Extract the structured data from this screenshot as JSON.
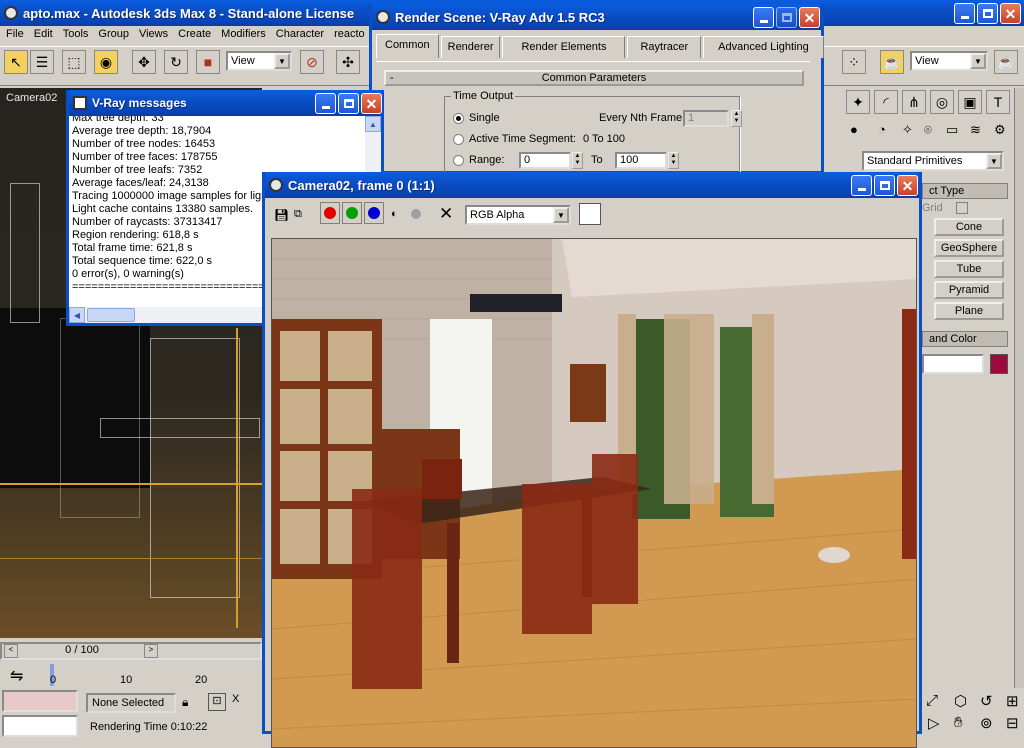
{
  "main_window": {
    "title": "apto.max - Autodesk 3ds Max 8   - Stand-alone License"
  },
  "menu": [
    "File",
    "Edit",
    "Tools",
    "Group",
    "Views",
    "Create",
    "Modifiers",
    "Character",
    "reacto"
  ],
  "toolbar": {
    "ref_coord": "View",
    "ref_coord_right": "View"
  },
  "viewport": {
    "label": "Camera02"
  },
  "vray_messages": {
    "title": "V-Ray messages",
    "lines": [
      "Max tree depth: 33",
      "Average tree depth: 18,7904",
      "Number of tree nodes: 16453",
      "Number of tree faces: 178755",
      "Number of tree leafs: 7352",
      "Average faces/leaf: 24,3138",
      "Tracing 1000000 image samples for ligh",
      "Light cache contains 13380 samples.",
      "Number of raycasts: 37313417",
      "Region rendering: 618,8 s",
      "Total frame time: 621,8 s",
      "Total sequence time: 622,0 s",
      "0 error(s), 0 warning(s)",
      "================================="
    ]
  },
  "render_scene": {
    "title": "Render Scene: V-Ray Adv 1.5 RC3",
    "tabs": [
      "Common",
      "Renderer",
      "Render Elements",
      "Raytracer",
      "Advanced Lighting"
    ],
    "rollout": "Common Parameters",
    "rollout_toggle": "-",
    "time_output": {
      "label": "Time Output",
      "single": "Single",
      "every_nth_label": "Every Nth Frame:",
      "every_nth_value": "1",
      "active_segment_label": "Active Time Segment:",
      "active_segment_value": "0 To 100",
      "range_label": "Range:",
      "range_from": "0",
      "range_to_label": "To",
      "range_to": "100"
    }
  },
  "frame_buffer": {
    "title": "Camera02, frame 0 (1:1)",
    "channel": "RGB Alpha",
    "colors": {
      "red": "#e00000",
      "green": "#00a000",
      "blue": "#0000d0"
    }
  },
  "command_panel": {
    "category": "Standard Primitives",
    "object_type": "ct Type",
    "autogrid": "Grid",
    "buttons": [
      "Cone",
      "GeoSphere",
      "Tube",
      "Pyramid",
      "Plane"
    ],
    "name_color": "and Color",
    "swatch_color": "#9a0a3a"
  },
  "timeline": {
    "frame": "0 / 100",
    "ticks": [
      "0",
      "10",
      "20"
    ]
  },
  "status": {
    "selection": "None Selected",
    "rendering_time": "Rendering Time  0:10:22"
  }
}
